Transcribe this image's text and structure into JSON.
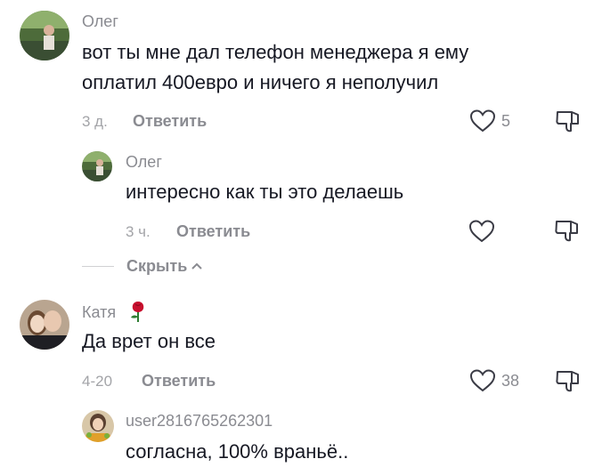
{
  "comments": [
    {
      "username": "Олег",
      "text_lines": [
        "вот ты мне дал телефон менеджера я ему",
        "оплатил 400евро и ничего я неполучил"
      ],
      "time": "3 д.",
      "reply_label": "Ответить",
      "likes": "5",
      "replies": [
        {
          "username": "Олег",
          "text": "интересно как ты это делаешь",
          "time": "3 ч.",
          "reply_label": "Ответить",
          "likes": ""
        }
      ],
      "hide_label": "Скрыть"
    },
    {
      "username": "Катя",
      "username_emoji": "rose-emoji",
      "text": "Да врет он все",
      "time": "4-20",
      "reply_label": "Ответить",
      "likes": "38",
      "replies": [
        {
          "username": "user2816765262301",
          "text": "согласна, 100% враньё.."
        }
      ]
    }
  ],
  "colors": {
    "text": "#161823",
    "secondary": "#8a8b91",
    "muted": "#a3a4a8",
    "rose": "#c8102e"
  }
}
